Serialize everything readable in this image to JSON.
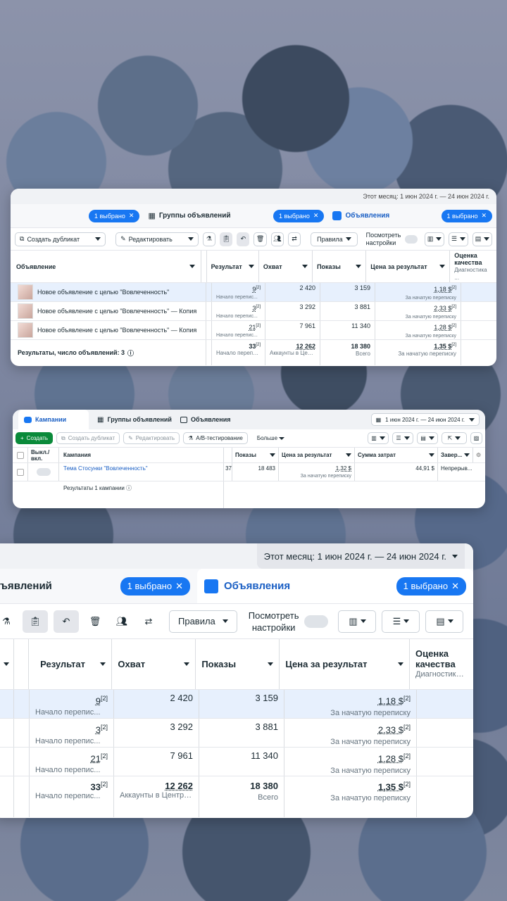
{
  "panel1": {
    "date_range": "Этот месяц: 1 июн 2024 г. — 24 июн 2024 г.",
    "selected_left": "1 выбрано",
    "tab_groups": "Группы объявлений",
    "selected_mid": "1 выбрано",
    "tab_ads": "Объявления",
    "selected_right": "1 выбрано",
    "toolbar": {
      "duplicate": "Создать дубликат",
      "edit": "Редактировать",
      "rules": "Правила",
      "view_settings_1": "Посмотреть",
      "view_settings_2": "настройки"
    },
    "columns": {
      "ad": "Объявление",
      "result": "Результат",
      "reach": "Охват",
      "impressions": "Показы",
      "cost": "Цена за результат",
      "quality_1": "Оценка",
      "quality_2": "качества",
      "quality_3": "Диагностика ..."
    },
    "rows": [
      {
        "name": "Новое объявление с целью \"Вовлеченность\"",
        "result": "9",
        "result_sup": "[2]",
        "result_sub": "Начало перепис...",
        "reach": "2 420",
        "impressions": "3 159",
        "cost": "1,18 $",
        "cost_sup": "[2]",
        "cost_sub": "За начатую переписку"
      },
      {
        "name": "Новое объявление с целью \"Вовлеченность\" — Копия",
        "result": "3",
        "result_sup": "[2]",
        "result_sub": "Начало перепис...",
        "reach": "3 292",
        "impressions": "3 881",
        "cost": "2,33 $",
        "cost_sup": "[2]",
        "cost_sub": "За начатую переписку"
      },
      {
        "name": "Новое объявление с целью \"Вовлеченность\" — Копия",
        "result": "21",
        "result_sup": "[2]",
        "result_sub": "Начало перепис...",
        "reach": "7 961",
        "impressions": "11 340",
        "cost": "1,28 $",
        "cost_sup": "[2]",
        "cost_sub": "За начатую переписку"
      }
    ],
    "total": {
      "label": "Результаты, число объявлений: 3",
      "result": "33",
      "result_sup": "[2]",
      "result_sub": "Начало перепис...",
      "reach": "12 262",
      "reach_sub": "Аккаунты в Центре ...",
      "impressions": "18 380",
      "impressions_sub": "Всего",
      "cost": "1,35 $",
      "cost_sup": "[2]",
      "cost_sub": "За начатую переписку"
    }
  },
  "panel2": {
    "tab_campaigns": "Кампании",
    "tab_groups": "Группы объявлений",
    "tab_ads": "Объявления",
    "date_range": "1 июн 2024 г. — 24 июн 2024 г.",
    "toolbar": {
      "create": "Создать",
      "duplicate": "Создать дубликат",
      "edit": "Редактировать",
      "ab_test": "A/B-тестирование",
      "more": "Больше"
    },
    "columns": {
      "onoff_1": "Выкл./",
      "onoff_2": "вкл.",
      "campaign": "Кампания",
      "impressions": "Показы",
      "cost": "Цена за результат",
      "spend": "Сумма затрат",
      "end": "Завер..."
    },
    "row": {
      "name": "Тема Стосунки \"Вовлеченность\"",
      "partial": "37",
      "impressions": "18 483",
      "cost": "1,32 $",
      "cost_sub": "За начатую переписку",
      "spend": "44,91 $",
      "end": "Непрерыв..."
    },
    "total_label": "Результаты 1 кампании"
  },
  "panel3": {
    "date_range": "Этот месяц: 1 июн 2024 г. — 24 июн 2024 г.",
    "tab_groups_partial": "ъявлений",
    "selected_left": "1 выбрано",
    "tab_ads": "Объявления",
    "selected_right": "1 выбрано",
    "rules": "Правила",
    "view_settings_1": "Посмотреть",
    "view_settings_2": "настройки",
    "columns": {
      "result": "Результат",
      "reach": "Охват",
      "impressions": "Показы",
      "cost": "Цена за результат",
      "quality_1": "Оценка",
      "quality_2": "качества",
      "quality_3": "Диагностика ..."
    },
    "rows": [
      {
        "result": "9",
        "result_sup": "[2]",
        "result_sub": "Начало перепис...",
        "reach": "2 420",
        "impressions": "3 159",
        "cost": "1,18 $",
        "cost_sup": "[2]",
        "cost_sub": "За начатую переписку"
      },
      {
        "result": "3",
        "result_sup": "[2]",
        "result_sub": "Начало перепис...",
        "reach": "3 292",
        "impressions": "3 881",
        "cost": "2,33 $",
        "cost_sup": "[2]",
        "cost_sub": "За начатую переписку"
      },
      {
        "result": "21",
        "result_sup": "[2]",
        "result_sub": "Начало перепис...",
        "reach": "7 961",
        "impressions": "11 340",
        "cost": "1,28 $",
        "cost_sup": "[2]",
        "cost_sub": "За начатую переписку"
      }
    ],
    "total": {
      "result": "33",
      "result_sup": "[2]",
      "result_sub": "Начало перепис...",
      "reach": "12 262",
      "reach_sub": "Аккаунты в Центре ...",
      "impressions": "18 380",
      "impressions_sub": "Всего",
      "cost": "1,35 $",
      "cost_sup": "[2]",
      "cost_sub": "За начатую переписку"
    }
  },
  "colors": {
    "accent": "#1877f2",
    "create_green": "#0a8a3a",
    "highlight_row": "#e7f0fd"
  }
}
